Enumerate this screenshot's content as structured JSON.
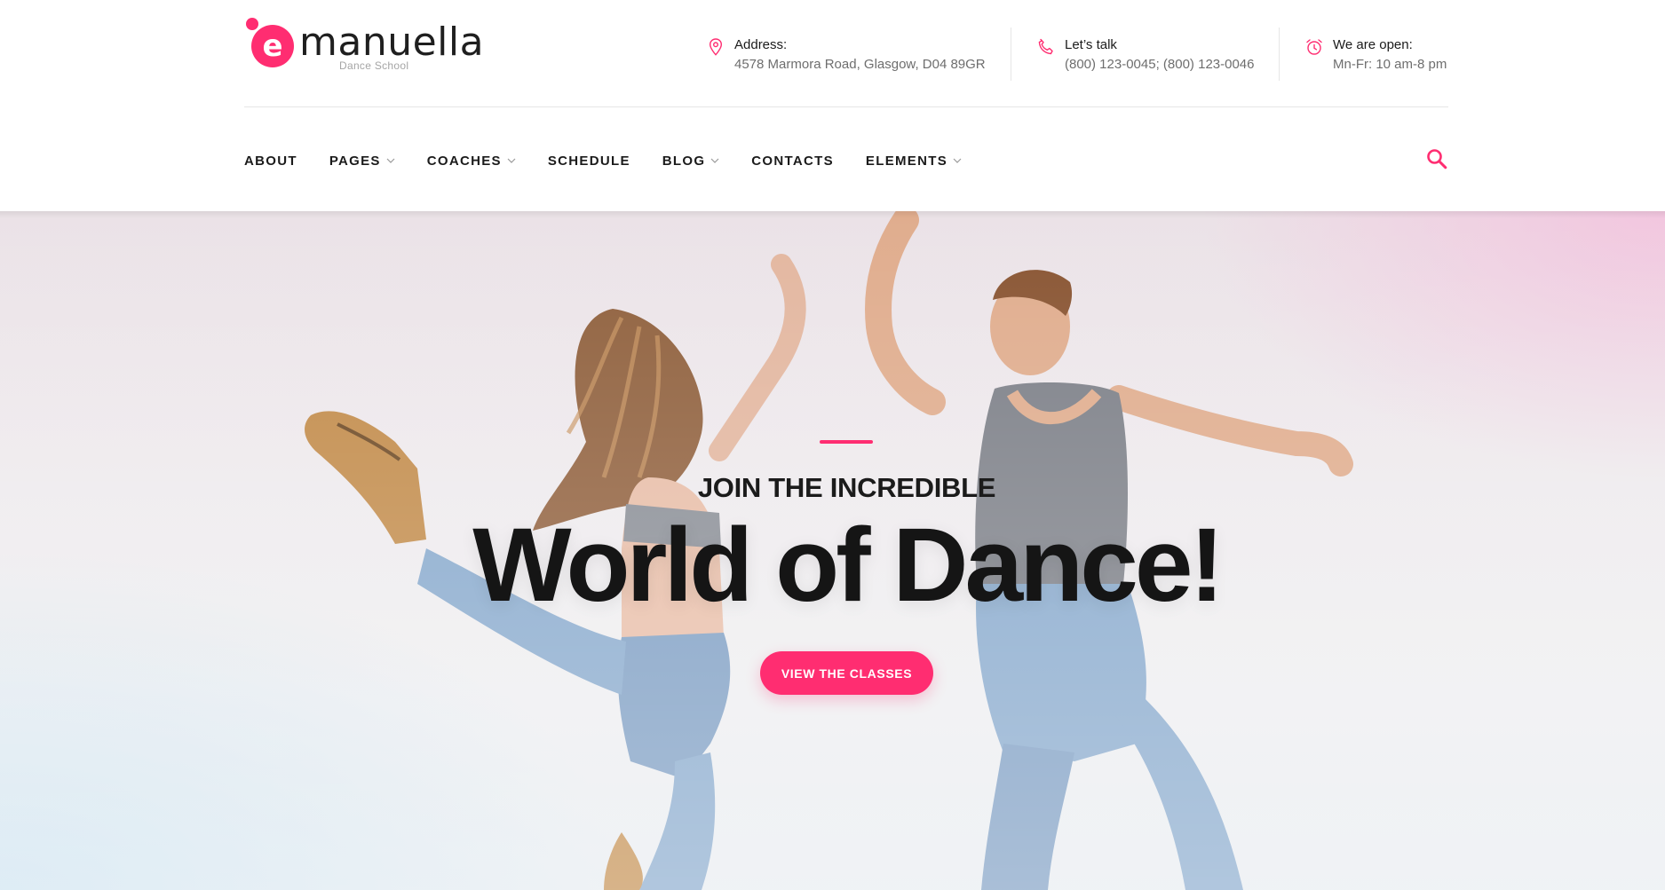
{
  "brand": {
    "name": "manuella",
    "logo_letter": "e",
    "tagline": "Dance School",
    "accent_color": "#ff2d71"
  },
  "contacts": {
    "address": {
      "icon": "map-pin-icon",
      "label": "Address:",
      "value": "4578 Marmora Road, Glasgow, D04 89GR"
    },
    "phone": {
      "icon": "phone-icon",
      "label": "Let’s talk",
      "value": "(800) 123-0045; (800) 123-0046"
    },
    "hours": {
      "icon": "alarm-clock-icon",
      "label": "We are open:",
      "value": "Mn-Fr: 10 am-8 pm"
    }
  },
  "nav": {
    "items": [
      {
        "label": "ABOUT",
        "has_dropdown": false
      },
      {
        "label": "PAGES",
        "has_dropdown": true
      },
      {
        "label": "COACHES",
        "has_dropdown": true
      },
      {
        "label": "SCHEDULE",
        "has_dropdown": false
      },
      {
        "label": "BLOG",
        "has_dropdown": true
      },
      {
        "label": "CONTACTS",
        "has_dropdown": false
      },
      {
        "label": "ELEMENTS",
        "has_dropdown": true
      }
    ],
    "search_icon": "search-icon"
  },
  "hero": {
    "kicker": "JOIN THE INCREDIBLE",
    "title": "World of Dance!",
    "button_label": "VIEW THE CLASSES"
  }
}
